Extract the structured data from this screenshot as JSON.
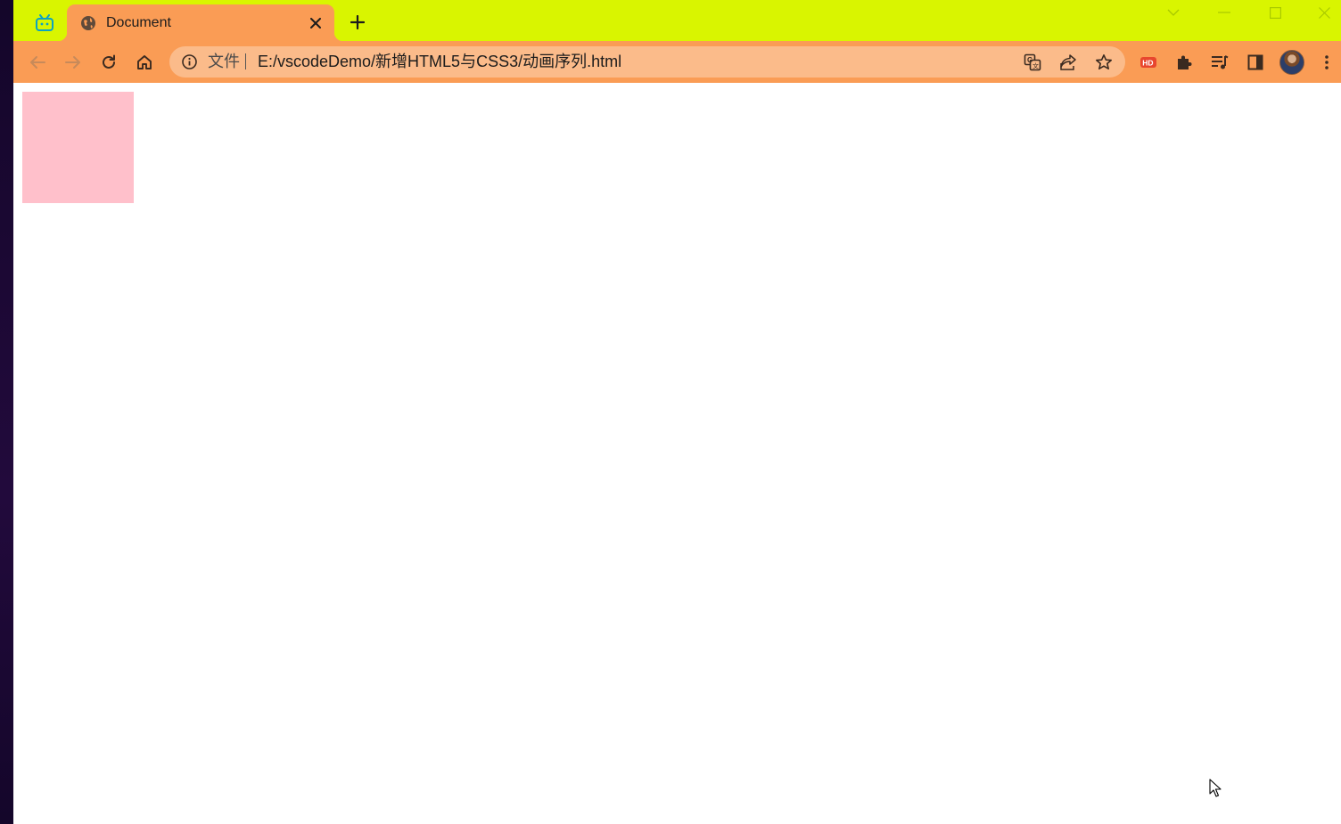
{
  "tab": {
    "title": "Document"
  },
  "omnibox": {
    "scheme_label": "文件",
    "url": "E:/vscodeDemo/新增HTML5与CSS3/动画序列.html"
  },
  "colors": {
    "tabstrip_bg": "#d9f500",
    "toolbar_bg": "#fa9c55",
    "omnibox_bg": "#fbbb8a",
    "box_color": "#ffc0cb"
  },
  "icons": {
    "tab_search": "tv-icon",
    "favicon": "globe-icon",
    "extensions": [
      "translate-icon",
      "share-icon",
      "bookmark-star-icon",
      "hd-extension-icon",
      "puzzle-icon",
      "media-queue-icon",
      "side-panel-icon"
    ]
  }
}
